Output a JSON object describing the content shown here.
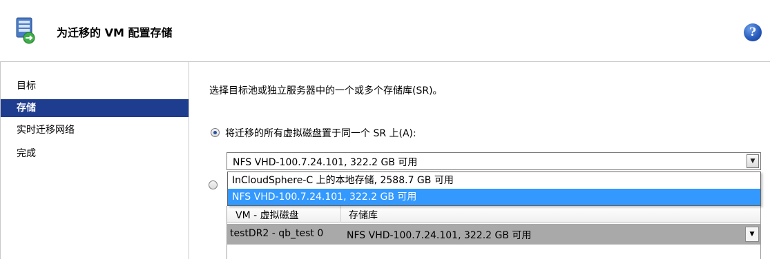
{
  "header": {
    "title": "为迁移的 VM 配置存储",
    "wizard_icon": "server-migrate-icon",
    "help_icon": "help-icon",
    "help_glyph": "?"
  },
  "sidebar": {
    "items": [
      {
        "label": "目标",
        "active": false
      },
      {
        "label": "存储",
        "active": true
      },
      {
        "label": "实时迁移网络",
        "active": false
      },
      {
        "label": "完成",
        "active": false
      }
    ]
  },
  "main": {
    "instruction": "选择目标池或独立服务器中的一个或多个存储库(SR)。",
    "option_same_sr": {
      "label": "将迁移的所有虚拟磁盘置于同一个 SR 上(A):",
      "checked": true
    },
    "option_per_disk": {
      "label": "",
      "checked": false
    },
    "sr_select": {
      "value": "NFS VHD-100.7.24.101, 322.2 GB 可用",
      "options": [
        "InCloudSphere-C 上的本地存储, 2588.7 GB 可用",
        "NFS VHD-100.7.24.101, 322.2 GB 可用"
      ],
      "highlighted_index": 1
    },
    "disk_grid": {
      "columns": [
        "VM - 虚拟磁盘",
        "存储库"
      ],
      "rows": [
        {
          "disk": "testDR2 - qb_test 0",
          "sr": "NFS VHD-100.7.24.101, 322.2 GB 可用"
        }
      ]
    }
  },
  "colors": {
    "nav_active_bg": "#1f3d8f",
    "dropdown_highlight": "#3399ff",
    "grid_row_bg": "#a9a9a9"
  }
}
